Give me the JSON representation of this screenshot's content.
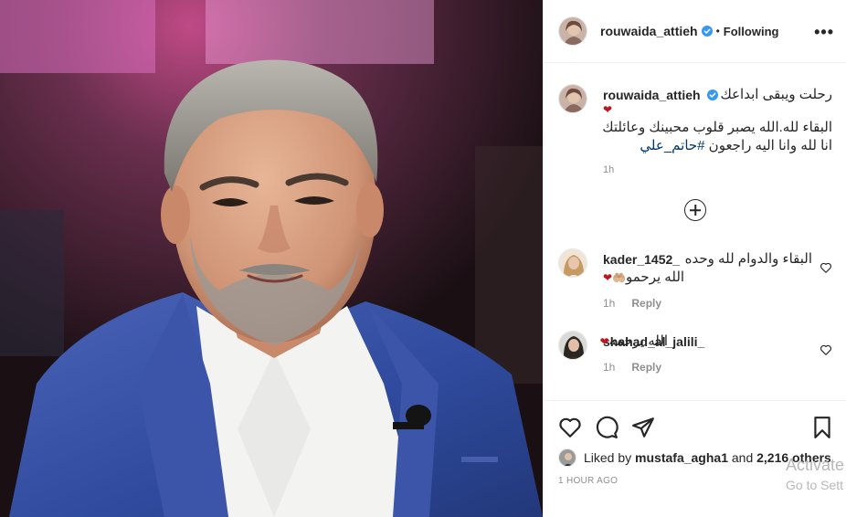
{
  "post": {
    "image_alt": "portrait photo",
    "author": {
      "username": "rouwaida_attieh",
      "verified": true,
      "follow_status": "Following",
      "more_icon": "more-options-icon"
    },
    "caption": {
      "line1": "رحلت ويبقى ابداعك",
      "heart": "❤",
      "line2": "البقاء لله.الله يصبر قلوب محبينك وعائلتك",
      "line3_text": "انا لله وانا اليه راجعون ",
      "hashtag": "#حاتم_علي",
      "time": "1h"
    },
    "load_more_icon": "plus-circle-icon",
    "comments": [
      {
        "username": "kader_1452_",
        "text_line1": "البقاء والدوام لله وحده",
        "text_line2": "الله يرحمو",
        "emojis": "🤲🏼❤",
        "time": "1h",
        "reply": "Reply"
      },
      {
        "username": "shahad_al_jalili_",
        "text_line1": "الله يرحمه",
        "emojis": "❤",
        "time": "1h",
        "reply": "Reply"
      }
    ],
    "actions": {
      "like_icon": "heart-icon",
      "comment_icon": "comment-icon",
      "share_icon": "share-icon",
      "save_icon": "bookmark-icon"
    },
    "likes": {
      "prefix": "Liked by",
      "user": "mustafa_agha1",
      "conj": "and",
      "others": "2,216 others"
    },
    "timestamp": "1 HOUR AGO"
  },
  "watermark": {
    "line1": "Activate",
    "line2": "Go to Sett"
  },
  "colors": {
    "text": "#262626",
    "secondary": "#8e8e8e",
    "verified": "#3897f0",
    "heart": "#c0151e",
    "hashtag": "#00376b",
    "border": "#efefef"
  }
}
